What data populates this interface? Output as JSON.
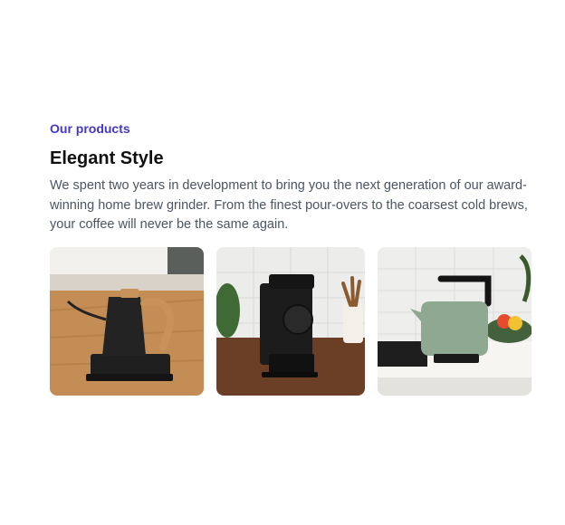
{
  "section": {
    "eyebrow": "Our products",
    "title": "Elegant Style",
    "description": "We spent two years in development to bring you the next generation of our award-winning home brew grinder. From the finest pour-overs to the coarsest cold brews, your coffee will never be the same again."
  },
  "gallery": {
    "images": [
      {
        "subject": "kettle-photo"
      },
      {
        "subject": "grinder-photo"
      },
      {
        "subject": "electric-kettle-photo"
      }
    ]
  }
}
